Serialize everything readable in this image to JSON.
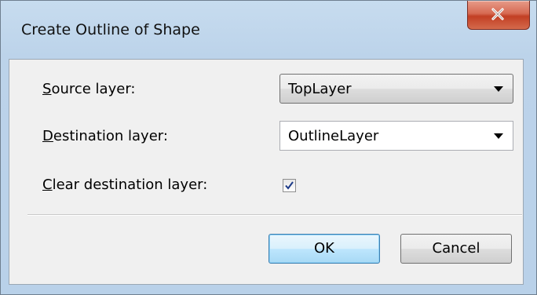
{
  "window": {
    "title": "Create Outline of Shape",
    "close_icon": "close-icon"
  },
  "form": {
    "source_layer": {
      "label_mnemonic": "S",
      "label_rest": "ource layer:",
      "value": "TopLayer"
    },
    "destination_layer": {
      "label_mnemonic": "D",
      "label_rest": "estination layer:",
      "value": "OutlineLayer"
    },
    "clear_destination": {
      "label_mnemonic": "C",
      "label_rest": "lear destination layer:",
      "checked": true
    }
  },
  "buttons": {
    "ok_label": "OK",
    "cancel_label": "Cancel"
  },
  "colors": {
    "close_button": "#c94a32",
    "default_button_border": "#3c7fb1",
    "checkmark": "#1c3a88"
  }
}
